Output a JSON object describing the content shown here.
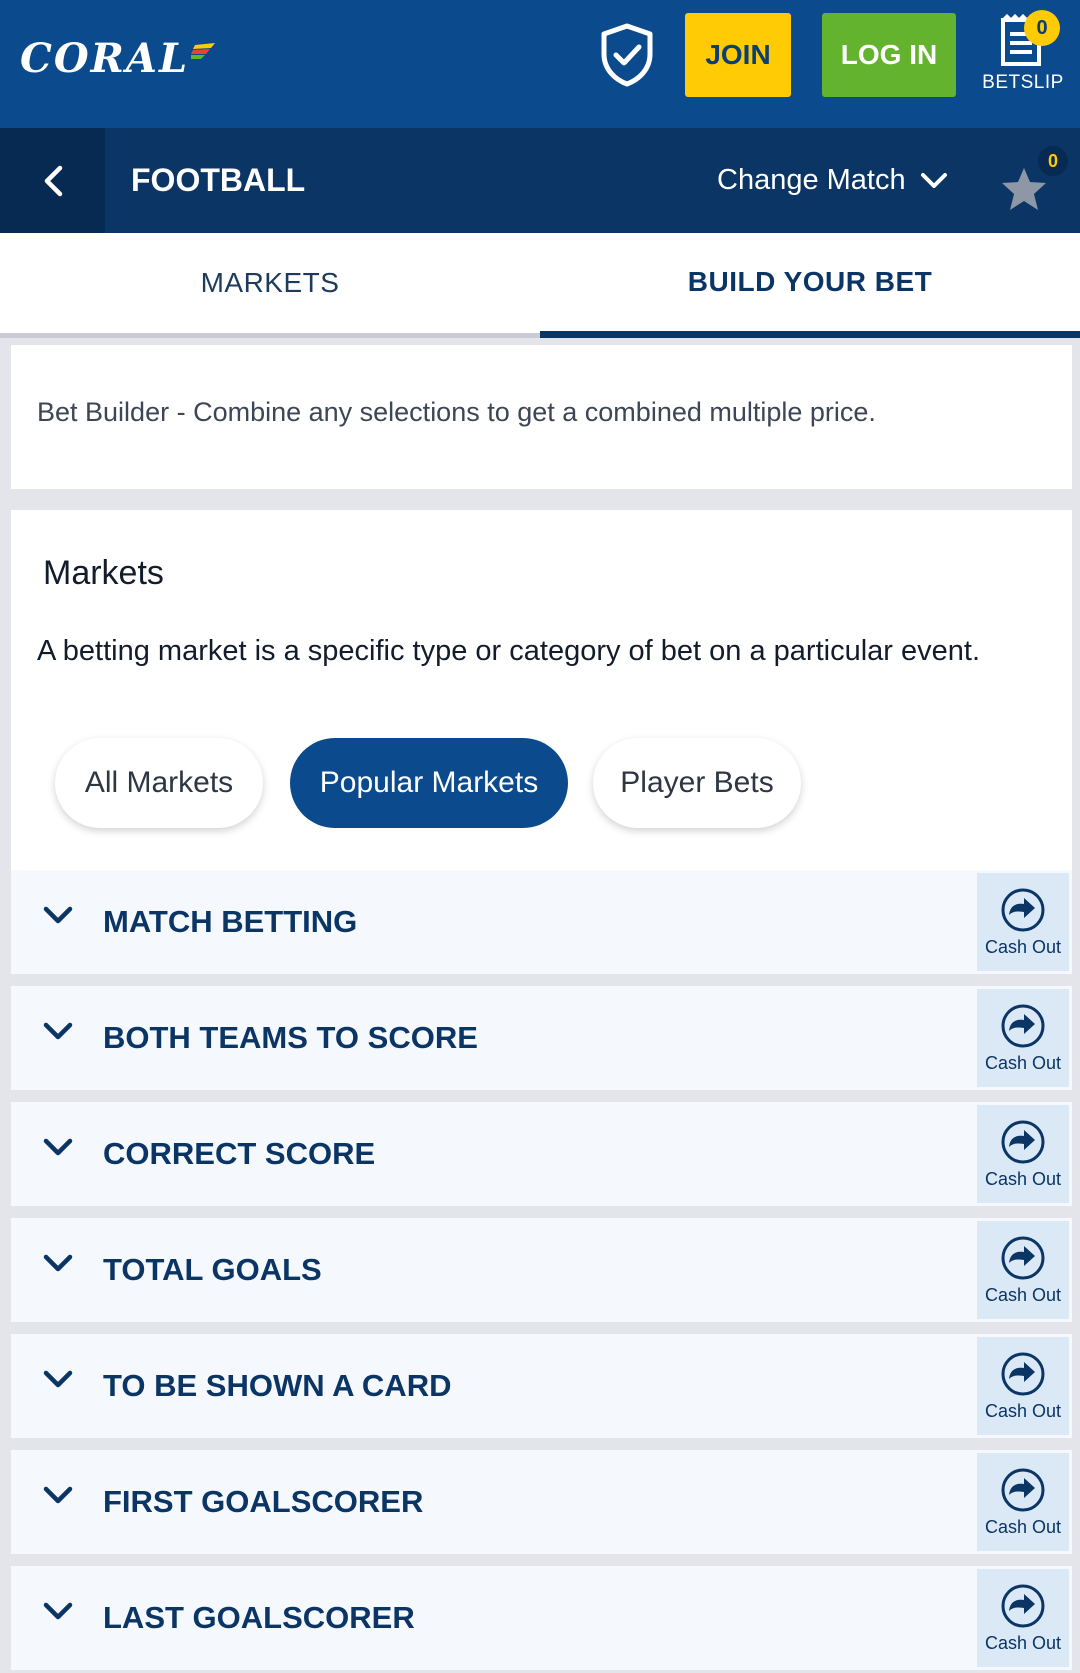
{
  "header": {
    "logo_text": "CORAL",
    "join_label": "JOIN",
    "login_label": "LOG IN",
    "betslip_label": "BETSLIP",
    "betslip_count": "0",
    "colors": {
      "header_bg": "#0b4a8c",
      "join_bg": "#ffcb05",
      "login_bg": "#63b32e"
    }
  },
  "subheader": {
    "sport_title": "FOOTBALL",
    "change_match_label": "Change Match",
    "favourites_count": "0"
  },
  "tabs": [
    {
      "label": "MARKETS",
      "active": false
    },
    {
      "label": "BUILD YOUR BET",
      "active": true
    }
  ],
  "info": {
    "text": "Bet Builder - Combine any selections to get a combined multiple price."
  },
  "markets_section": {
    "title": "Markets",
    "description": "A betting market is a specific type or category of bet on a particular event.",
    "filters": [
      {
        "label": "All Markets",
        "selected": false
      },
      {
        "label": "Popular Markets",
        "selected": true
      },
      {
        "label": "Player Bets",
        "selected": false
      }
    ]
  },
  "market_rows": [
    {
      "label": "MATCH BETTING",
      "cashout_label": "Cash Out"
    },
    {
      "label": "BOTH TEAMS TO SCORE",
      "cashout_label": "Cash Out"
    },
    {
      "label": "CORRECT SCORE",
      "cashout_label": "Cash Out"
    },
    {
      "label": "TOTAL GOALS",
      "cashout_label": "Cash Out"
    },
    {
      "label": "TO BE SHOWN A CARD",
      "cashout_label": "Cash Out"
    },
    {
      "label": "FIRST GOALSCORER",
      "cashout_label": "Cash Out"
    },
    {
      "label": "LAST GOALSCORER",
      "cashout_label": "Cash Out"
    }
  ]
}
